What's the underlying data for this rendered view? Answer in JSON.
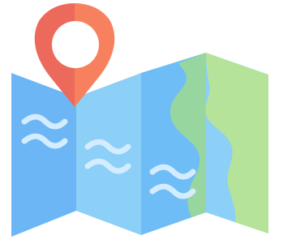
{
  "icon": {
    "semantic_name": "folded-map-with-location-pin-icon",
    "pin": "map-pin-icon",
    "waves": "water-waves-icon"
  },
  "colors": {
    "background": "#ffffff",
    "panel_1_water": "#6CB6F5",
    "panel_2_water": "#8CCFF7",
    "panel_3_water": "#6FBDF6",
    "panel_4_water": "#8CCFF7",
    "fold_shadow": "#5AA7EE",
    "land": "#B5E39A",
    "land_shadow": "#98D69F",
    "wave": "#D4ECFF",
    "pin_left": "#EC6A5C",
    "pin_right": "#F7815F",
    "pin_hole": "#FFFFFF"
  }
}
